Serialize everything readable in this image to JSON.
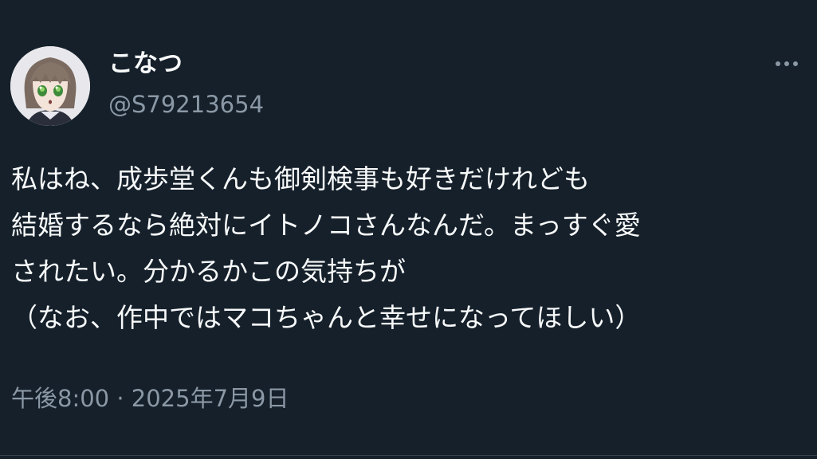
{
  "user": {
    "display_name": "こなつ",
    "handle": "@S79213654",
    "avatar_icon": "anime-avatar-icon"
  },
  "menu": {
    "more_icon": "more-horizontal-icon"
  },
  "tweet": {
    "lines": [
      "私はね、成歩堂くんも御剣検事も好きだけれども",
      "結婚するなら絶対にイトノコさんなんだ。まっすぐ愛",
      "されたい。分かるかこの気持ちが",
      "（なお、作中ではマコちゃんと幸せになってほしい）"
    ],
    "time": "午後8:00",
    "separator": "·",
    "date": "2025年7月9日"
  },
  "colors": {
    "background": "#15202b",
    "text_primary": "#f7f9f9",
    "text_secondary": "#8b98a5",
    "divider": "#38444d"
  }
}
